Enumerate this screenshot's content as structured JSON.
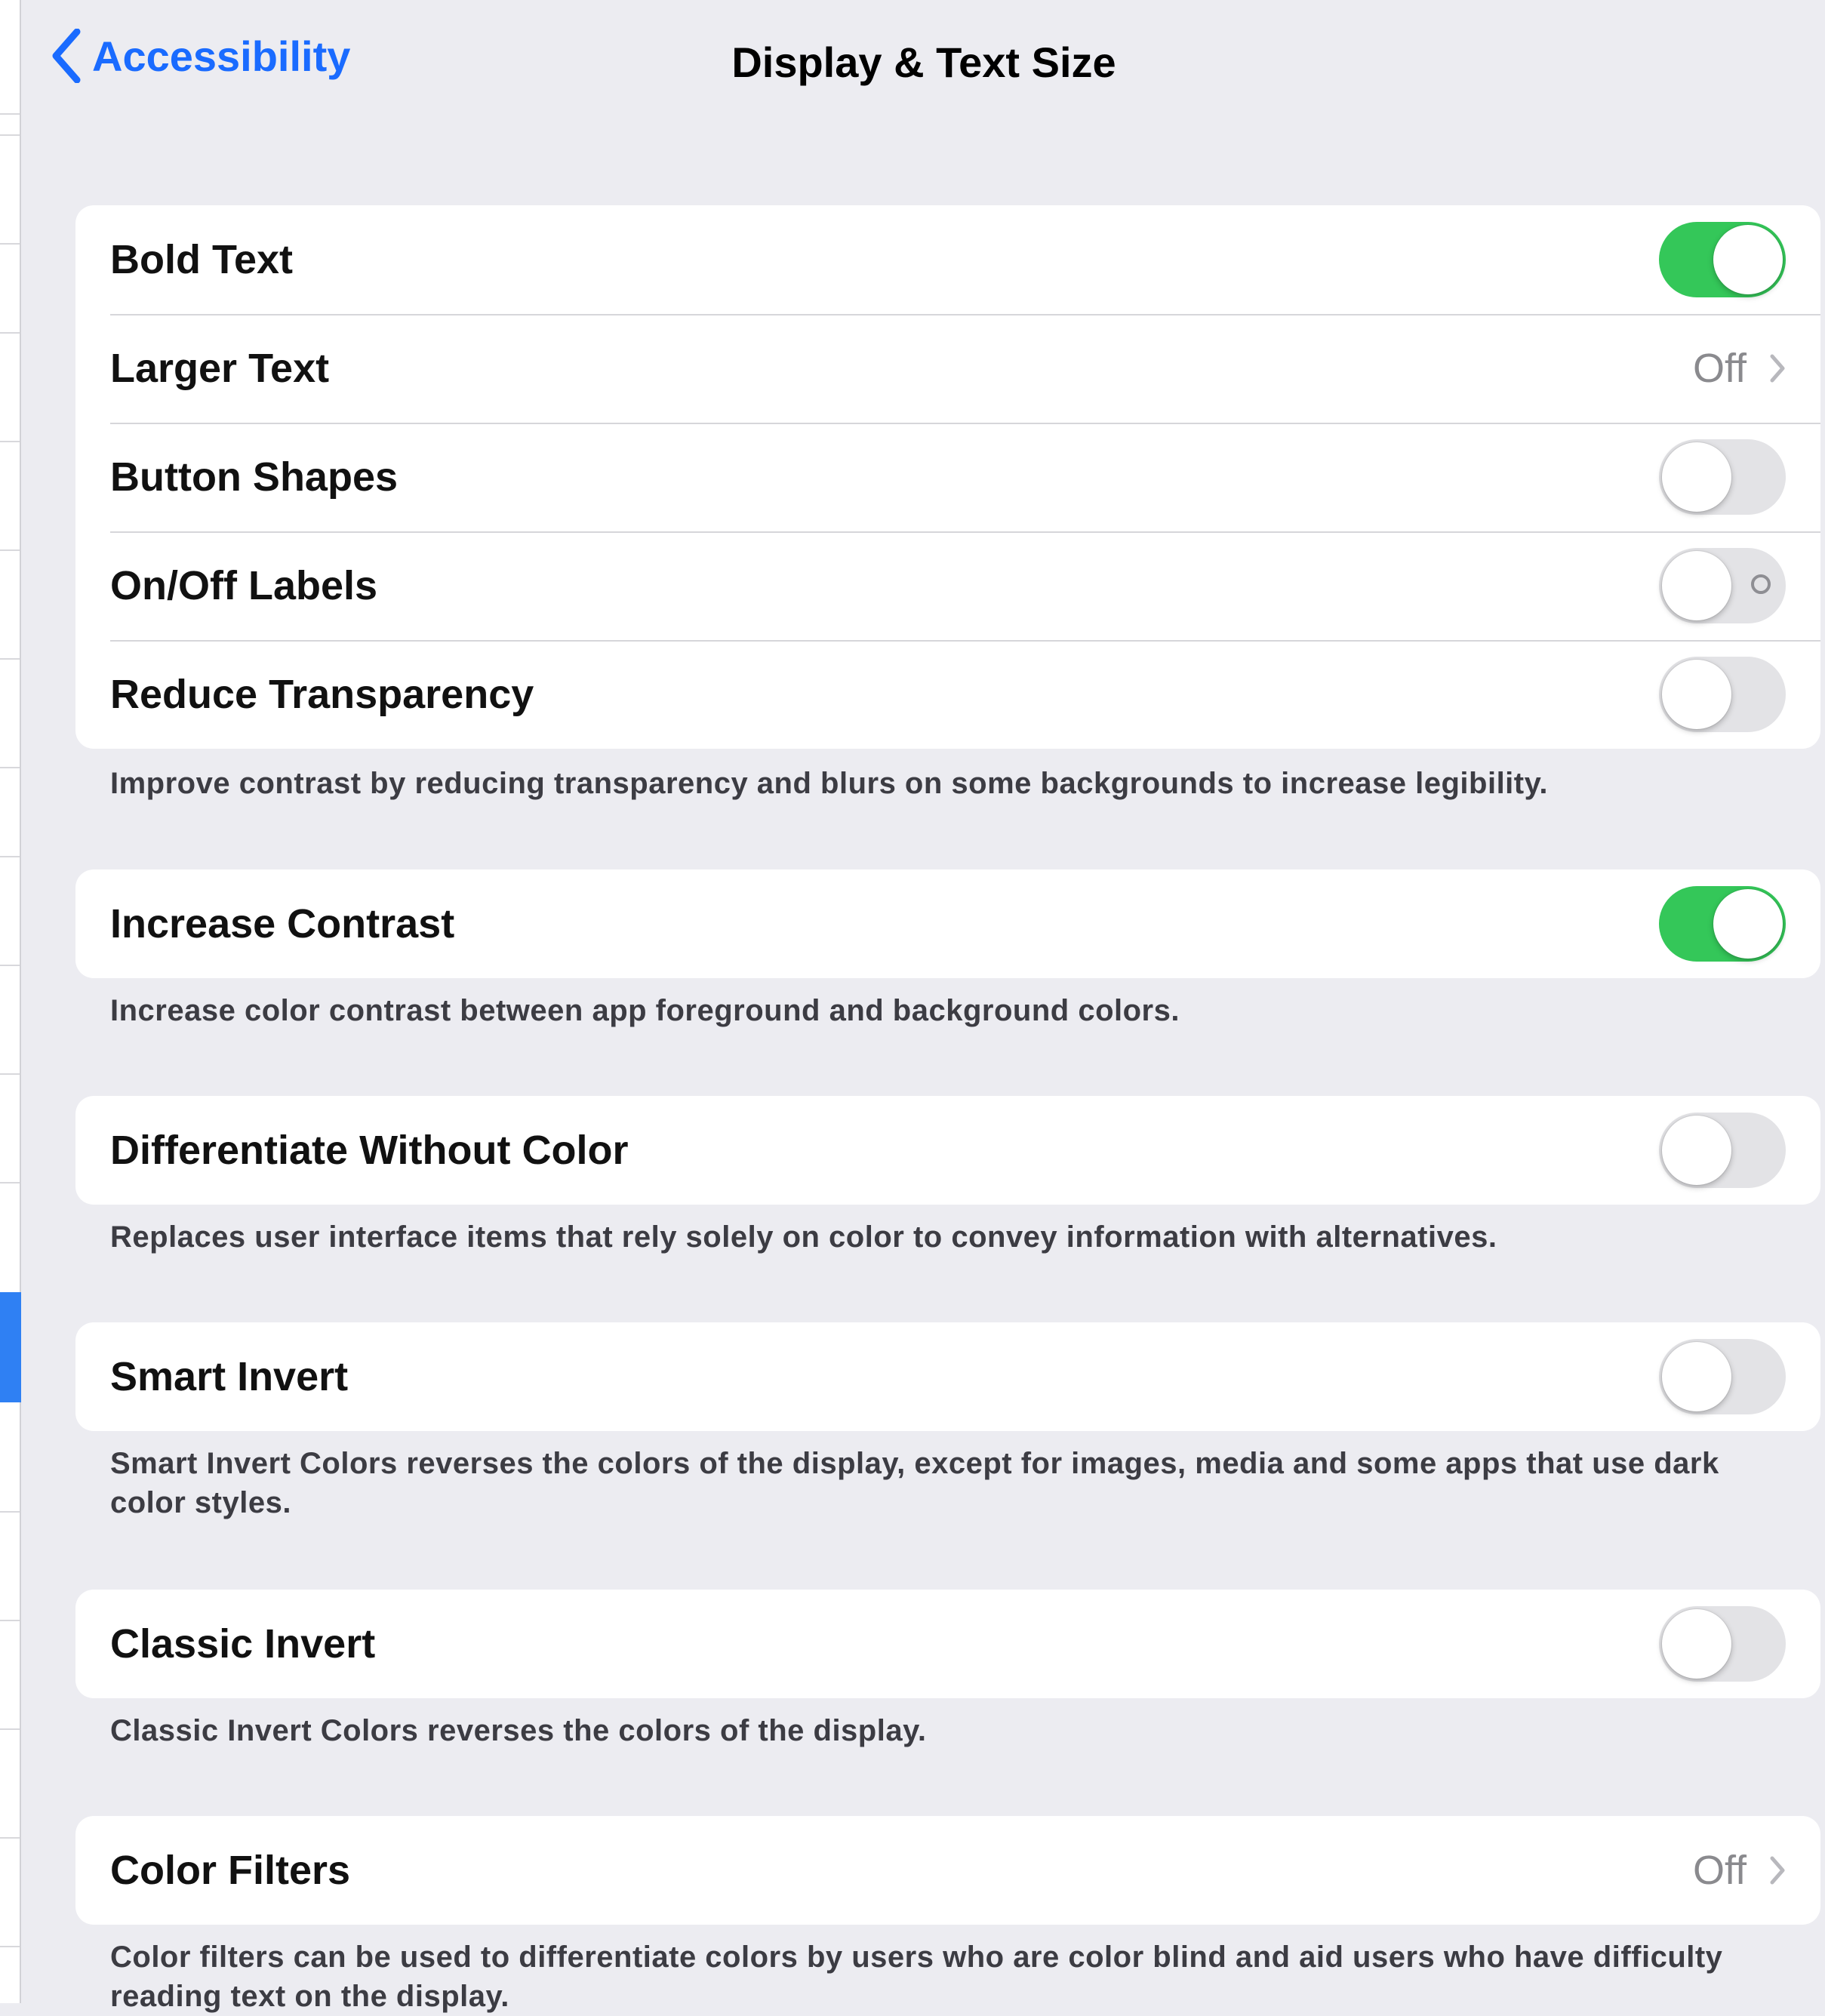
{
  "nav": {
    "back_label": "Accessibility",
    "title": "Display & Text Size",
    "back_icon": "chevron-left-icon"
  },
  "colors": {
    "accent": "#1a6bff",
    "toggle_on": "#34c759",
    "toggle_off": "#e3e3e6",
    "background": "#ececf1",
    "selected_sidebar": "#2f80f3"
  },
  "group_text": {
    "rows": [
      {
        "label": "Bold Text",
        "control": "toggle",
        "on": true
      },
      {
        "label": "Larger Text",
        "control": "disclosure",
        "value": "Off"
      },
      {
        "label": "Button Shapes",
        "control": "toggle",
        "on": false
      },
      {
        "label": "On/Off Labels",
        "control": "toggle",
        "on": false
      },
      {
        "label": "Reduce Transparency",
        "control": "toggle",
        "on": false
      }
    ],
    "footer": "Improve contrast by reducing transparency and blurs on some backgrounds to increase legibility."
  },
  "group_contrast": {
    "label": "Increase Contrast",
    "on": true,
    "footer": "Increase color contrast between app foreground and background colors."
  },
  "group_differentiate": {
    "label": "Differentiate Without Color",
    "on": false,
    "footer": "Replaces user interface items that rely solely on color to convey information with alternatives."
  },
  "group_smart_invert": {
    "label": "Smart Invert",
    "on": false,
    "footer": "Smart Invert Colors reverses the colors of the display, except for images, media and some apps that use dark color styles."
  },
  "group_classic_invert": {
    "label": "Classic Invert",
    "on": false,
    "footer": "Classic Invert Colors reverses the colors of the display."
  },
  "group_color_filters": {
    "label": "Color Filters",
    "value": "Off",
    "footer": "Color filters can be used to differentiate colors by users who are color blind and aid users who have difficulty reading text on the display."
  }
}
